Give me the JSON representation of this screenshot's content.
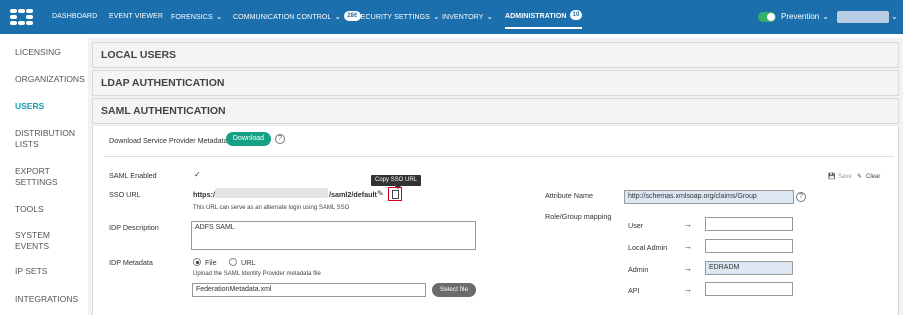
{
  "nav": {
    "items": [
      {
        "label": "DASHBOARD"
      },
      {
        "label": "EVENT VIEWER"
      },
      {
        "label": "FORENSICS"
      },
      {
        "label": "COMMUNICATION CONTROL",
        "badge": "286"
      },
      {
        "label": "SECURITY SETTINGS"
      },
      {
        "label": "INVENTORY"
      },
      {
        "label": "ADMINISTRATION",
        "badge": "10"
      }
    ],
    "mode": "Prevention"
  },
  "sidebar": {
    "items": [
      {
        "label": "LICENSING"
      },
      {
        "label": "ORGANIZATIONS"
      },
      {
        "label": "USERS"
      },
      {
        "label": "DISTRIBUTION LISTS"
      },
      {
        "label": "EXPORT SETTINGS"
      },
      {
        "label": "TOOLS"
      },
      {
        "label": "SYSTEM EVENTS"
      },
      {
        "label": "IP SETS"
      },
      {
        "label": "INTEGRATIONS"
      }
    ]
  },
  "sections": {
    "local_users": "LOCAL USERS",
    "ldap": "LDAP AUTHENTICATION",
    "saml": "SAML AUTHENTICATION"
  },
  "saml": {
    "download_label": "Download Service Provider Metadata",
    "download_button": "Download",
    "enabled_label": "SAML Enabled",
    "enabled_check": "✓",
    "save": "Save",
    "clear": "Clear",
    "sso_label": "SSO URL",
    "sso_prefix": "https://",
    "sso_suffix": "/saml2/default",
    "sso_note": "This URL can serve as an alternate login using SAML SSO",
    "copy_tooltip": "Copy SSO URL",
    "idp_desc_label": "IDP Description",
    "idp_desc_value": "ADFS SAML",
    "idp_meta_label": "IDP Metadata",
    "radio_file": "File",
    "radio_url": "URL",
    "upload_note": "Upload the SAML Identity Provider metadata file",
    "file_value": "FederationMetadata.xml",
    "select_file": "Select file",
    "attr_label": "Attribute Name",
    "attr_value": "http://schemas.xmlsoap.org/claims/Group",
    "role_label": "Role/Group mapping",
    "roles": [
      {
        "label": "User",
        "value": ""
      },
      {
        "label": "Local Admin",
        "value": ""
      },
      {
        "label": "Admin",
        "value": "EDRADM"
      },
      {
        "label": "API",
        "value": ""
      }
    ]
  }
}
